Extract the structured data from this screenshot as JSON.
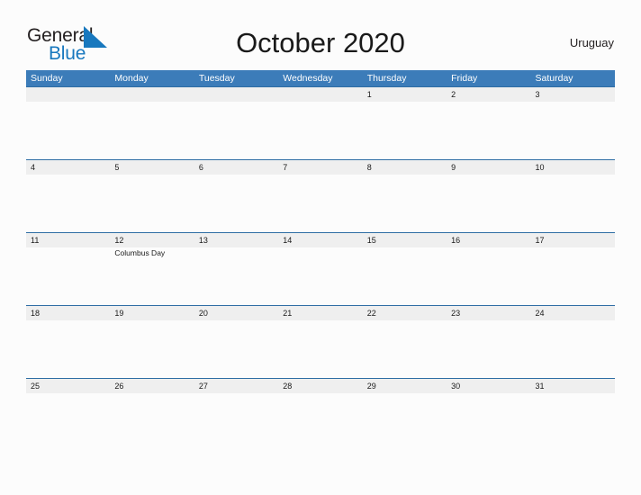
{
  "logo": {
    "word_one": "General",
    "word_two": "Blue",
    "flag_icon": "blue-triangle-flag-icon",
    "flag_color": "#1878be"
  },
  "header": {
    "title": "October 2020",
    "region": "Uruguay"
  },
  "colors": {
    "header_blue": "#3c7cb9",
    "row_rule_blue": "#2e6da4",
    "date_strip_gray": "#efefef",
    "page_background": "#fcfcfc",
    "text_dark": "#1a1a1a",
    "logo_blue": "#1878be"
  },
  "calendar": {
    "weekdays": [
      "Sunday",
      "Monday",
      "Tuesday",
      "Wednesday",
      "Thursday",
      "Friday",
      "Saturday"
    ],
    "weeks": [
      {
        "days": [
          {
            "date": "",
            "event": ""
          },
          {
            "date": "",
            "event": ""
          },
          {
            "date": "",
            "event": ""
          },
          {
            "date": "",
            "event": ""
          },
          {
            "date": "1",
            "event": ""
          },
          {
            "date": "2",
            "event": ""
          },
          {
            "date": "3",
            "event": ""
          }
        ]
      },
      {
        "days": [
          {
            "date": "4",
            "event": ""
          },
          {
            "date": "5",
            "event": ""
          },
          {
            "date": "6",
            "event": ""
          },
          {
            "date": "7",
            "event": ""
          },
          {
            "date": "8",
            "event": ""
          },
          {
            "date": "9",
            "event": ""
          },
          {
            "date": "10",
            "event": ""
          }
        ]
      },
      {
        "days": [
          {
            "date": "11",
            "event": ""
          },
          {
            "date": "12",
            "event": "Columbus Day"
          },
          {
            "date": "13",
            "event": ""
          },
          {
            "date": "14",
            "event": ""
          },
          {
            "date": "15",
            "event": ""
          },
          {
            "date": "16",
            "event": ""
          },
          {
            "date": "17",
            "event": ""
          }
        ]
      },
      {
        "days": [
          {
            "date": "18",
            "event": ""
          },
          {
            "date": "19",
            "event": ""
          },
          {
            "date": "20",
            "event": ""
          },
          {
            "date": "21",
            "event": ""
          },
          {
            "date": "22",
            "event": ""
          },
          {
            "date": "23",
            "event": ""
          },
          {
            "date": "24",
            "event": ""
          }
        ]
      },
      {
        "days": [
          {
            "date": "25",
            "event": ""
          },
          {
            "date": "26",
            "event": ""
          },
          {
            "date": "27",
            "event": ""
          },
          {
            "date": "28",
            "event": ""
          },
          {
            "date": "29",
            "event": ""
          },
          {
            "date": "30",
            "event": ""
          },
          {
            "date": "31",
            "event": ""
          }
        ]
      }
    ]
  }
}
